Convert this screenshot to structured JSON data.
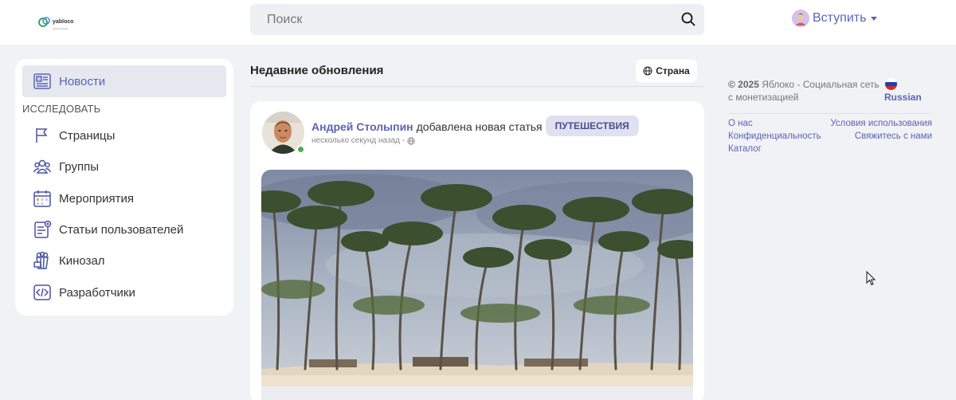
{
  "header": {
    "logo_text": "yabloco",
    "logo_sub": "social network",
    "search_placeholder": "Поиск",
    "join_label": "Вступить"
  },
  "sidebar": {
    "active": {
      "label": "Новости",
      "icon": "newspaper-icon"
    },
    "section_label": "ИССЛЕДОВАТЬ",
    "items": [
      {
        "label": "Страницы",
        "icon": "flag-icon"
      },
      {
        "label": "Группы",
        "icon": "users-icon"
      },
      {
        "label": "Мероприятия",
        "icon": "calendar-icon"
      },
      {
        "label": "Статьи пользователей",
        "icon": "article-icon"
      },
      {
        "label": "Кинозал",
        "icon": "popcorn-icon"
      },
      {
        "label": "Разработчики",
        "icon": "code-icon"
      }
    ]
  },
  "feed": {
    "title": "Недавние обновления",
    "country_button": "Страна",
    "post": {
      "author": "Андрей Столыпин",
      "action": "добавлена новая статья",
      "tag": "ПУТЕШЕСТВИЯ",
      "time": "несколько секунд назад -",
      "image": "palm-trees-beach"
    }
  },
  "footer": {
    "copyright_year": "© 2025",
    "copyright_text": "Яблоко - Социальная сеть с монетизацией",
    "language": "Russian",
    "links": {
      "about": "О нас",
      "terms": "Условия использования",
      "privacy": "Конфиденциальность",
      "contact": "Свяжитесь с нами",
      "catalog": "Каталог"
    }
  },
  "colors": {
    "accent": "#5b63b8",
    "background": "#f0f2f5",
    "online": "#4caf50"
  }
}
